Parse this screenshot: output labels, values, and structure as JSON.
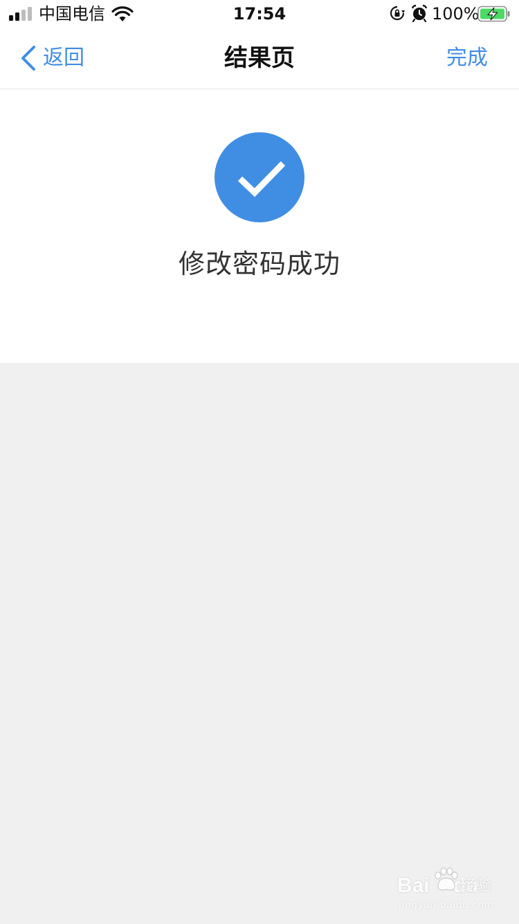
{
  "status_bar": {
    "carrier": "中国电信",
    "time": "17:54",
    "battery_percent": "100%",
    "signal_bars_active": 2,
    "signal_bars_total": 4,
    "icons": [
      "signal-icon",
      "wifi-icon",
      "rotation-lock-icon",
      "alarm-icon",
      "battery-charging-icon"
    ]
  },
  "nav": {
    "back_label": "返回",
    "title": "结果页",
    "done_label": "完成"
  },
  "result": {
    "icon": "check-circle-icon",
    "message": "修改密码成功"
  },
  "watermark": {
    "brand": "Bai",
    "brand_suffix": "du",
    "product": "经验",
    "url": "jingyan.baidu.com"
  },
  "colors": {
    "accent": "#3f8ee3",
    "page_background": "#f0f0f0",
    "panel_background": "#ffffff",
    "battery_fill": "#4cd964"
  }
}
